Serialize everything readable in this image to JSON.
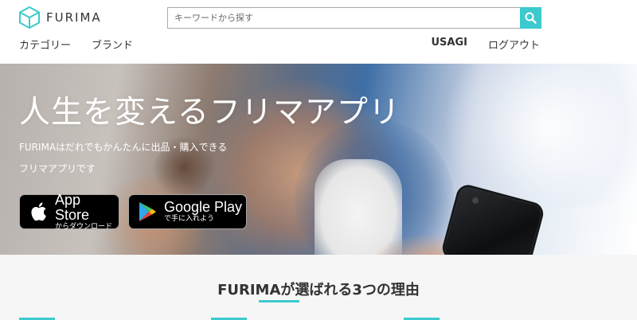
{
  "header": {
    "logo_text": "FURIMA",
    "search": {
      "placeholder": "キーワードから探す",
      "value": ""
    },
    "nav_left": [
      "カテゴリー",
      "ブランド"
    ],
    "user_name": "USAGI",
    "logout_label": "ログアウト"
  },
  "hero": {
    "title": "人生を変えるフリマアプリ",
    "subtitle_line1": "FURIMAはだれでもかんたんに出品・購入できる",
    "subtitle_line2": "フリマアプリです",
    "app_store": {
      "big": "App Store",
      "small": "からダウンロード"
    },
    "google_play": {
      "big": "Google Play",
      "small": "で手に入れよう"
    }
  },
  "reasons": {
    "title": "FURIMAが選ばれる3つの理由"
  },
  "colors": {
    "accent": "#3ccace",
    "text": "#333333",
    "section_bg": "#f6f6f6"
  },
  "icons": [
    "furima-cube-logo-icon",
    "search-icon",
    "apple-icon",
    "google-play-icon"
  ]
}
